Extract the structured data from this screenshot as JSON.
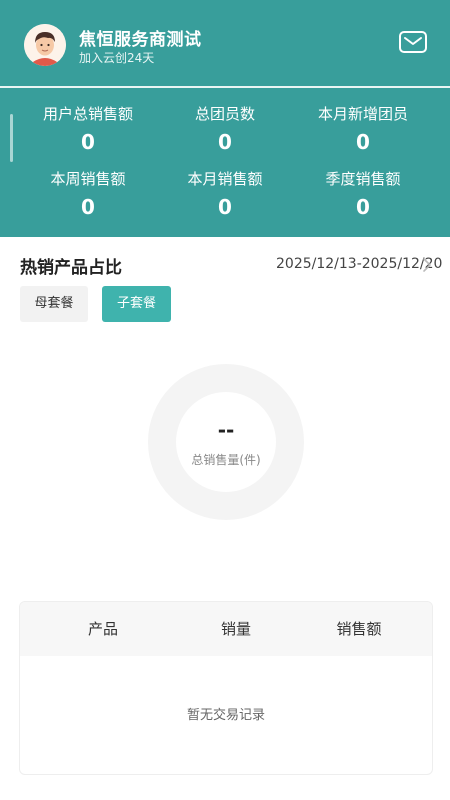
{
  "profile": {
    "name": "焦恒服务商测试",
    "joined": "加入云创24天",
    "mail_icon": "envelope-icon"
  },
  "stats": [
    {
      "label": "用户总销售额",
      "value": "0"
    },
    {
      "label": "总团员数",
      "value": "0"
    },
    {
      "label": "本月新增团员",
      "value": "0"
    },
    {
      "label": "本周销售额",
      "value": "0"
    },
    {
      "label": "本月销售额",
      "value": "0"
    },
    {
      "label": "季度销售额",
      "value": "0"
    }
  ],
  "hot_products": {
    "title": "热销产品占比",
    "date_range": "2025/12/13-2025/12/20",
    "tabs": [
      {
        "label": "母套餐",
        "active": false
      },
      {
        "label": "子套餐",
        "active": true
      }
    ],
    "donut": {
      "value": "--",
      "label": "总销售量(件)"
    }
  },
  "table": {
    "columns": [
      "产品",
      "销量",
      "销售额"
    ],
    "empty_text": "暂无交易记录"
  },
  "colors": {
    "header_bg": "#389e9b",
    "accent": "#3fb3ad"
  }
}
